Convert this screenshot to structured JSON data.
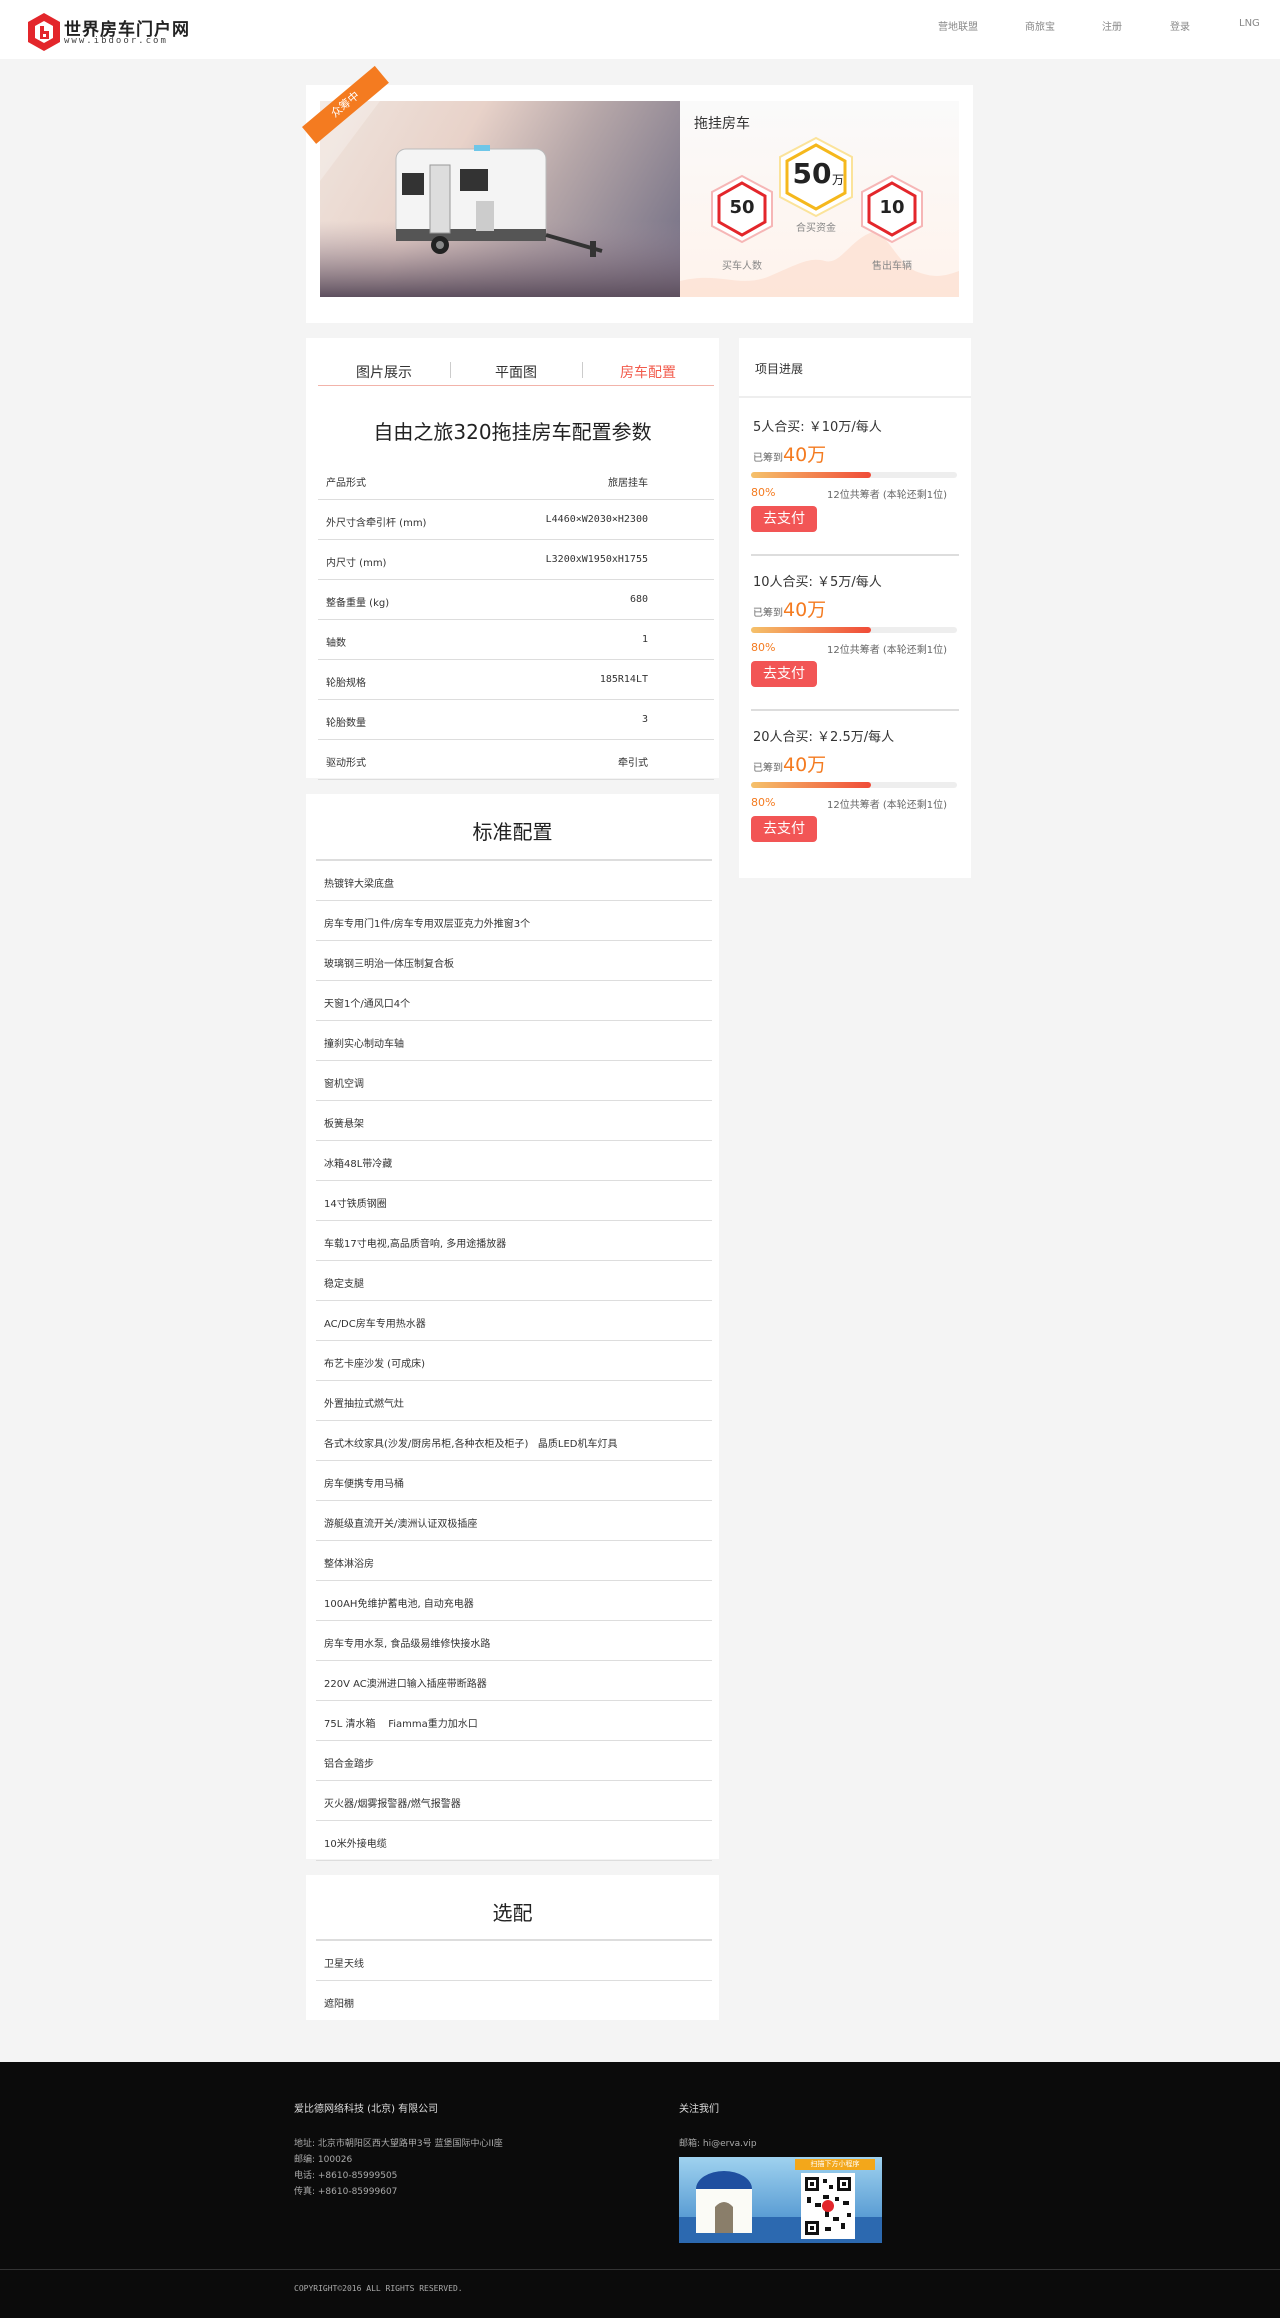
{
  "header": {
    "logo_title": "世界房车门户网",
    "logo_url": "www.ibdoor.com",
    "nav": [
      "营地联盟",
      "商旅宝",
      "注册",
      "登录",
      "LNG"
    ]
  },
  "banner": {
    "badge": "众筹中",
    "title": "拖挂房车",
    "hex_center": {
      "value": "50",
      "unit": "万",
      "caption": "合买资金"
    },
    "hex_left": {
      "value": "50",
      "caption": "买车人数"
    },
    "hex_right": {
      "value": "10",
      "caption": "售出车辆"
    }
  },
  "tabs": [
    "图片展示",
    "平面图",
    "房车配置"
  ],
  "params": {
    "title": "自由之旅320拖挂房车配置参数",
    "rows": [
      {
        "k": "产品形式",
        "v": "旅居挂车"
      },
      {
        "k": "外尺寸含牵引杆 (mm)",
        "v": "L4460×W2030×H2300"
      },
      {
        "k": "内尺寸 (mm)",
        "v": "L3200xW1950xH1755"
      },
      {
        "k": "整备重量 (kg)",
        "v": "680"
      },
      {
        "k": "轴数",
        "v": "1"
      },
      {
        "k": "轮胎规格",
        "v": "185R14LT"
      },
      {
        "k": "轮胎数量",
        "v": "3"
      },
      {
        "k": "驱动形式",
        "v": "牵引式"
      }
    ]
  },
  "standard": {
    "title": "标准配置",
    "items": [
      "热镀锌大梁底盘",
      "房车专用门1件/房车专用双层亚克力外推窗3个",
      "玻璃钢三明治一体压制复合板",
      "天窗1个/通风口4个",
      "撞刹实心制动车轴",
      "窗机空调",
      "板簧悬架",
      "冰箱48L带冷藏",
      "14寸铁质钢圈",
      "车载17寸电视,高品质音响, 多用途播放器",
      "稳定支腿",
      "AC/DC房车专用热水器",
      "布艺卡座沙发 (可成床)",
      "外置抽拉式燃气灶",
      "各式木纹家具(沙发/厨房吊柜,各种衣柜及柜子)   晶质LED机车灯具",
      "房车便携专用马桶",
      "游艇级直流开关/澳洲认证双极插座",
      "整体淋浴房",
      "100AH免维护蓄电池, 自动充电器",
      "房车专用水泵, 食品级易维修快接水路",
      "220V AC澳洲进口输入插座带断路器",
      "75L 清水箱    Fiamma重力加水口",
      "铝合金踏步",
      "灭火器/烟雾报警器/燃气报警器",
      "10米外接电缆"
    ]
  },
  "optional": {
    "title": "选配",
    "items": [
      "卫星天线",
      "遮阳棚"
    ]
  },
  "progress": {
    "title": "项目进展",
    "plans": [
      {
        "title": "5人合买: ￥10万/每人",
        "raised_label": "已筹到",
        "raised": "40万",
        "pct": "80%",
        "pct_value": 0.8,
        "note": "12位共筹者 (本轮还剩1位)",
        "pay": "去支付"
      },
      {
        "title": "10人合买: ￥5万/每人",
        "raised_label": "已筹到",
        "raised": "40万",
        "pct": "80%",
        "pct_value": 0.8,
        "note": "12位共筹者 (本轮还剩1位)",
        "pay": "去支付"
      },
      {
        "title": "20人合买: ￥2.5万/每人",
        "raised_label": "已筹到",
        "raised": "40万",
        "pct": "80%",
        "pct_value": 0.8,
        "note": "12位共筹者 (本轮还剩1位)",
        "pay": "去支付"
      }
    ]
  },
  "footer": {
    "company": "爱比德网络科技 (北京) 有限公司",
    "address": "地址: 北京市朝阳区西大望路甲3号 蓝堡国际中心II座",
    "postcode": "邮编: 100026",
    "phone": "电话: +8610-85999505",
    "fax": "传真: +8610-85999607",
    "follow": "关注我们",
    "email": "邮箱: hi@erva.vip",
    "qr_caption": "扫描下方小程序",
    "copyright": "COPYRIGHT©2016 ALL RIGHTS RESERVED."
  }
}
